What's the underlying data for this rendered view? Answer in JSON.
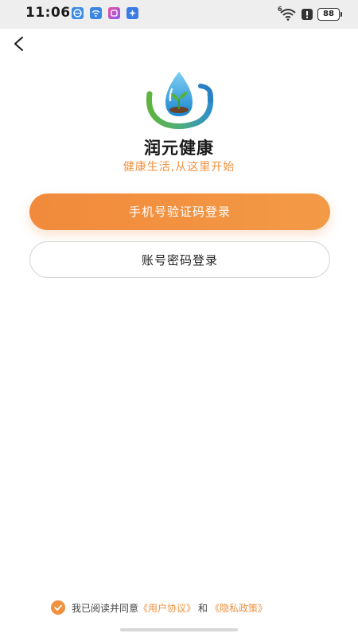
{
  "status_bar": {
    "time": "11:06",
    "signal_label": "6",
    "battery": "88",
    "notification_icons": [
      "browser-icon",
      "wifi-app-icon",
      "gallery-app-icon",
      "assistant-app-icon"
    ]
  },
  "header": {
    "back_icon": "chevron-left-icon"
  },
  "brand": {
    "logo_icon": "water-drop-seedling-logo",
    "app_name": "润元健康",
    "slogan": "健康生活,从这里开始"
  },
  "login": {
    "phone_code_button": "手机号验证码登录",
    "password_button": "账号密码登录"
  },
  "agreement": {
    "checked": true,
    "prefix": "我已阅读并同意",
    "user_agreement": "《用户协议》",
    "conjunction": "和",
    "privacy_policy": "《隐私政策》"
  },
  "colors": {
    "accent": "#f0913f",
    "primary_button": "#f18a3c",
    "status_bar_bg": "#eeeeee"
  }
}
